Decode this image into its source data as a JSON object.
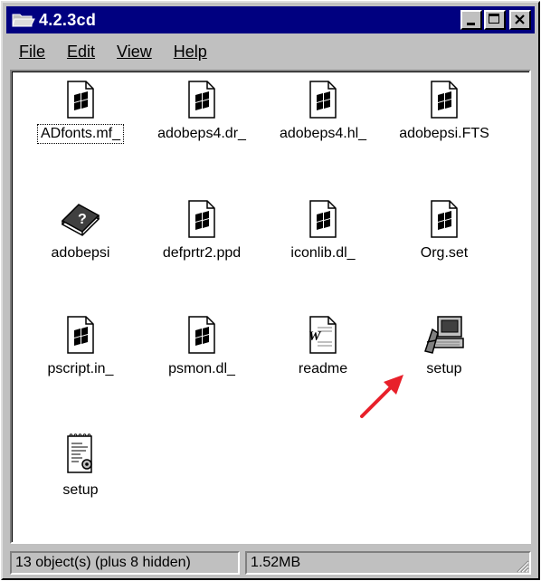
{
  "window": {
    "title": "4.2.3cd"
  },
  "menu": [
    "File",
    "Edit",
    "View",
    "Help"
  ],
  "files": [
    {
      "label": "ADfonts.mf_",
      "icon": "windows-file-icon",
      "focused": true
    },
    {
      "label": "adobeps4.dr_",
      "icon": "windows-file-icon"
    },
    {
      "label": "adobeps4.hl_",
      "icon": "windows-file-icon"
    },
    {
      "label": "adobepsi.FTS",
      "icon": "windows-file-icon"
    },
    {
      "label": "adobepsi",
      "icon": "help-book-icon"
    },
    {
      "label": "defprtr2.ppd",
      "icon": "windows-file-icon"
    },
    {
      "label": "iconlib.dl_",
      "icon": "windows-file-icon"
    },
    {
      "label": "Org.set",
      "icon": "windows-file-icon"
    },
    {
      "label": "pscript.in_",
      "icon": "windows-file-icon"
    },
    {
      "label": "psmon.dl_",
      "icon": "windows-file-icon"
    },
    {
      "label": "readme",
      "icon": "word-document-icon"
    },
    {
      "label": "setup",
      "icon": "setup-program-icon"
    },
    {
      "label": "setup",
      "icon": "setup-info-icon"
    }
  ],
  "status": {
    "objects": "13 object(s) (plus 8 hidden)",
    "size": "1.52MB"
  },
  "colors": {
    "titlebar": "#000080",
    "face": "#c0c0c0",
    "arrow": "#e8202a"
  }
}
